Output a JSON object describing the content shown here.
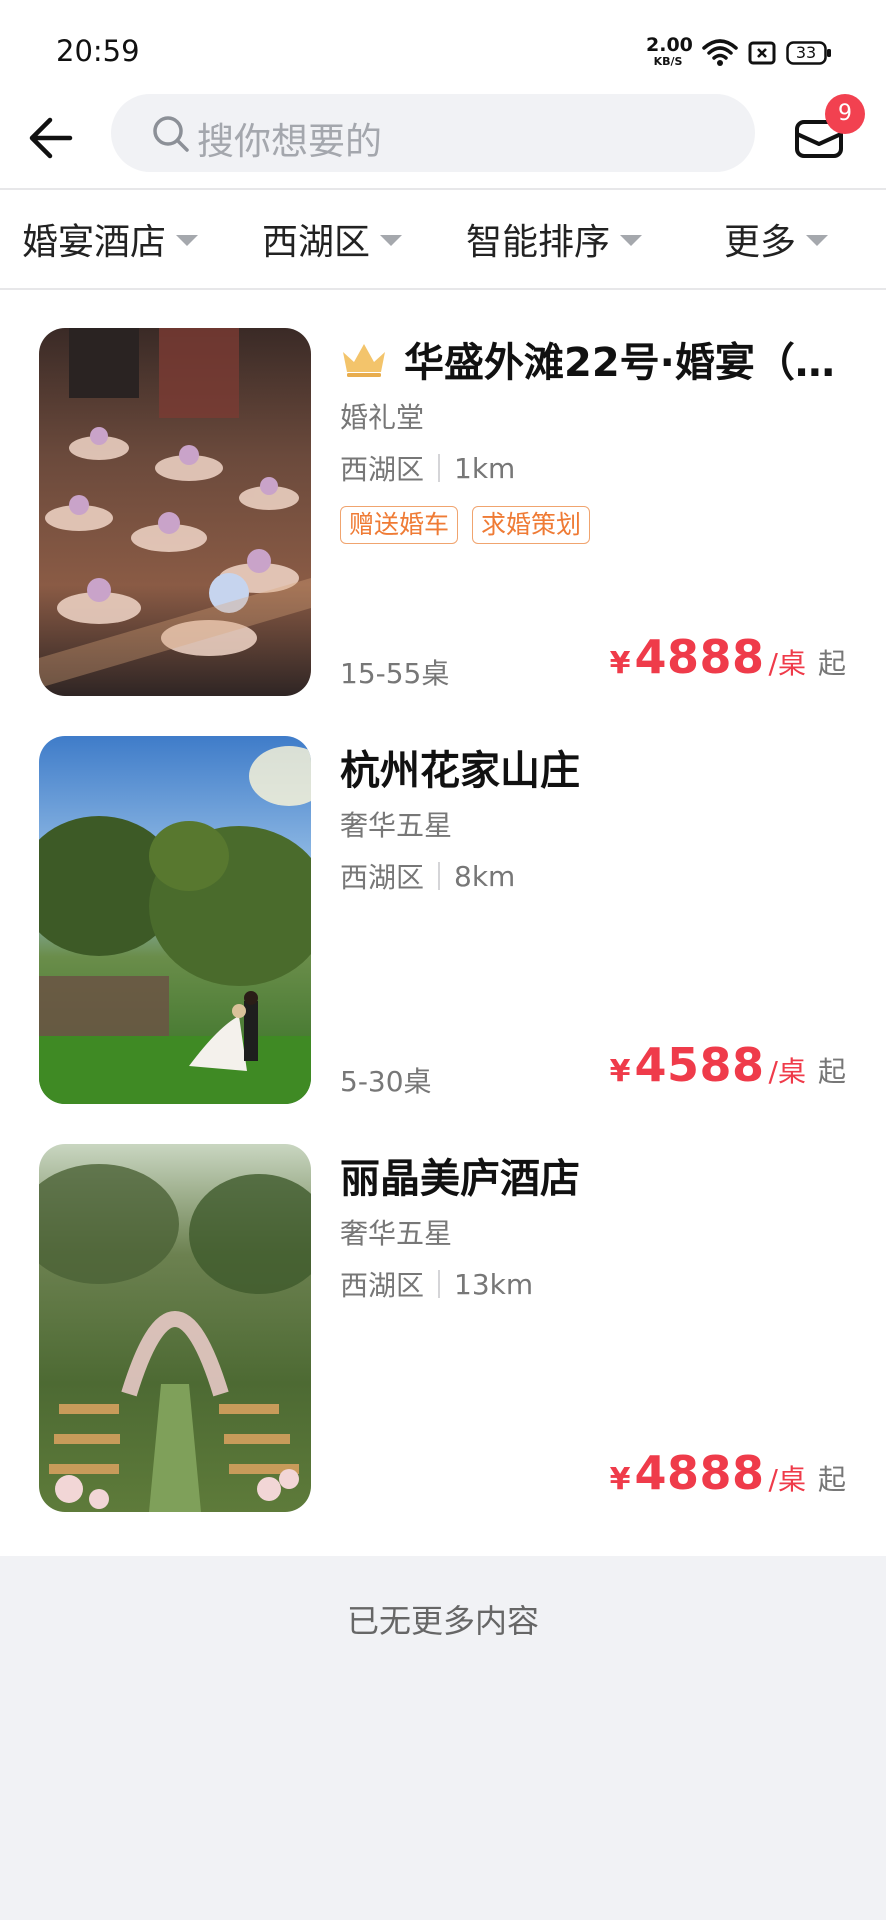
{
  "status_bar": {
    "time": "20:59",
    "net_speed_value": "2.00",
    "net_speed_unit": "KB/S",
    "battery": "33"
  },
  "header": {
    "search_placeholder": "搜你想要的",
    "message_badge": "9"
  },
  "filters": [
    {
      "label": "婚宴酒店"
    },
    {
      "label": "西湖区"
    },
    {
      "label": "智能排序"
    },
    {
      "label": "更多"
    }
  ],
  "venues": [
    {
      "title": "华盛外滩22号·婚宴（…",
      "crown": true,
      "type": "婚礼堂",
      "district": "西湖区",
      "distance": "1km",
      "tags": [
        "赠送婚车",
        "求婚策划"
      ],
      "tables": "15-55桌",
      "price_symbol": "¥",
      "price": "4888",
      "price_unit": "/桌",
      "price_from": "起"
    },
    {
      "title": "杭州花家山庄",
      "crown": false,
      "type": "奢华五星",
      "district": "西湖区",
      "distance": "8km",
      "tags": [],
      "tables": "5-30桌",
      "price_symbol": "¥",
      "price": "4588",
      "price_unit": "/桌",
      "price_from": "起"
    },
    {
      "title": "丽晶美庐酒店",
      "crown": false,
      "type": "奢华五星",
      "district": "西湖区",
      "distance": "13km",
      "tags": [],
      "tables": "",
      "price_symbol": "¥",
      "price": "4888",
      "price_unit": "/桌",
      "price_from": "起"
    }
  ],
  "footer": {
    "end_text": "已无更多内容"
  },
  "colors": {
    "price": "#ef3b4a",
    "tag": "#ef7b35",
    "badge": "#f24150",
    "search_bg": "#f1f2f5"
  }
}
